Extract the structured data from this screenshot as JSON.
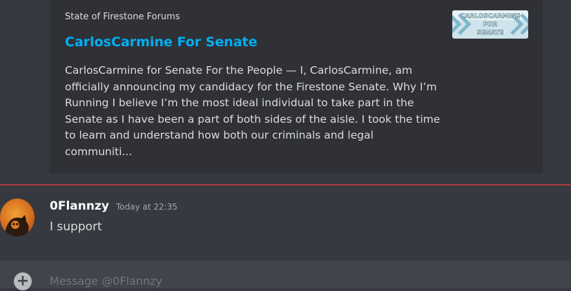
{
  "embed": {
    "provider": "State of Firestone Forums",
    "title": "CarlosCarmine For Senate",
    "description": "CarlosCarmine for Senate For the People — I, CarlosCarmine, am officially announcing my candidacy for the Firestone Senate. Why I’m Running I believe I’m the most ideal individual to take part in the Senate as I have been a part of both sides of the aisle. I took the time to learn and understand how both our criminals and legal communiti...",
    "thumbnail_text": [
      "CARLOSCARMINE",
      "FOR",
      "SENATE"
    ]
  },
  "message": {
    "author": "0Flannzy",
    "timestamp": "Today at 22:35",
    "text": "I support"
  },
  "composer": {
    "placeholder": "Message @0Flannzy",
    "add_icon": "plus-circle-icon"
  },
  "colors": {
    "background": "#36393f",
    "embed_background": "#2f3136",
    "link": "#00aff4",
    "new_messages_divider": "#a83c3c"
  }
}
